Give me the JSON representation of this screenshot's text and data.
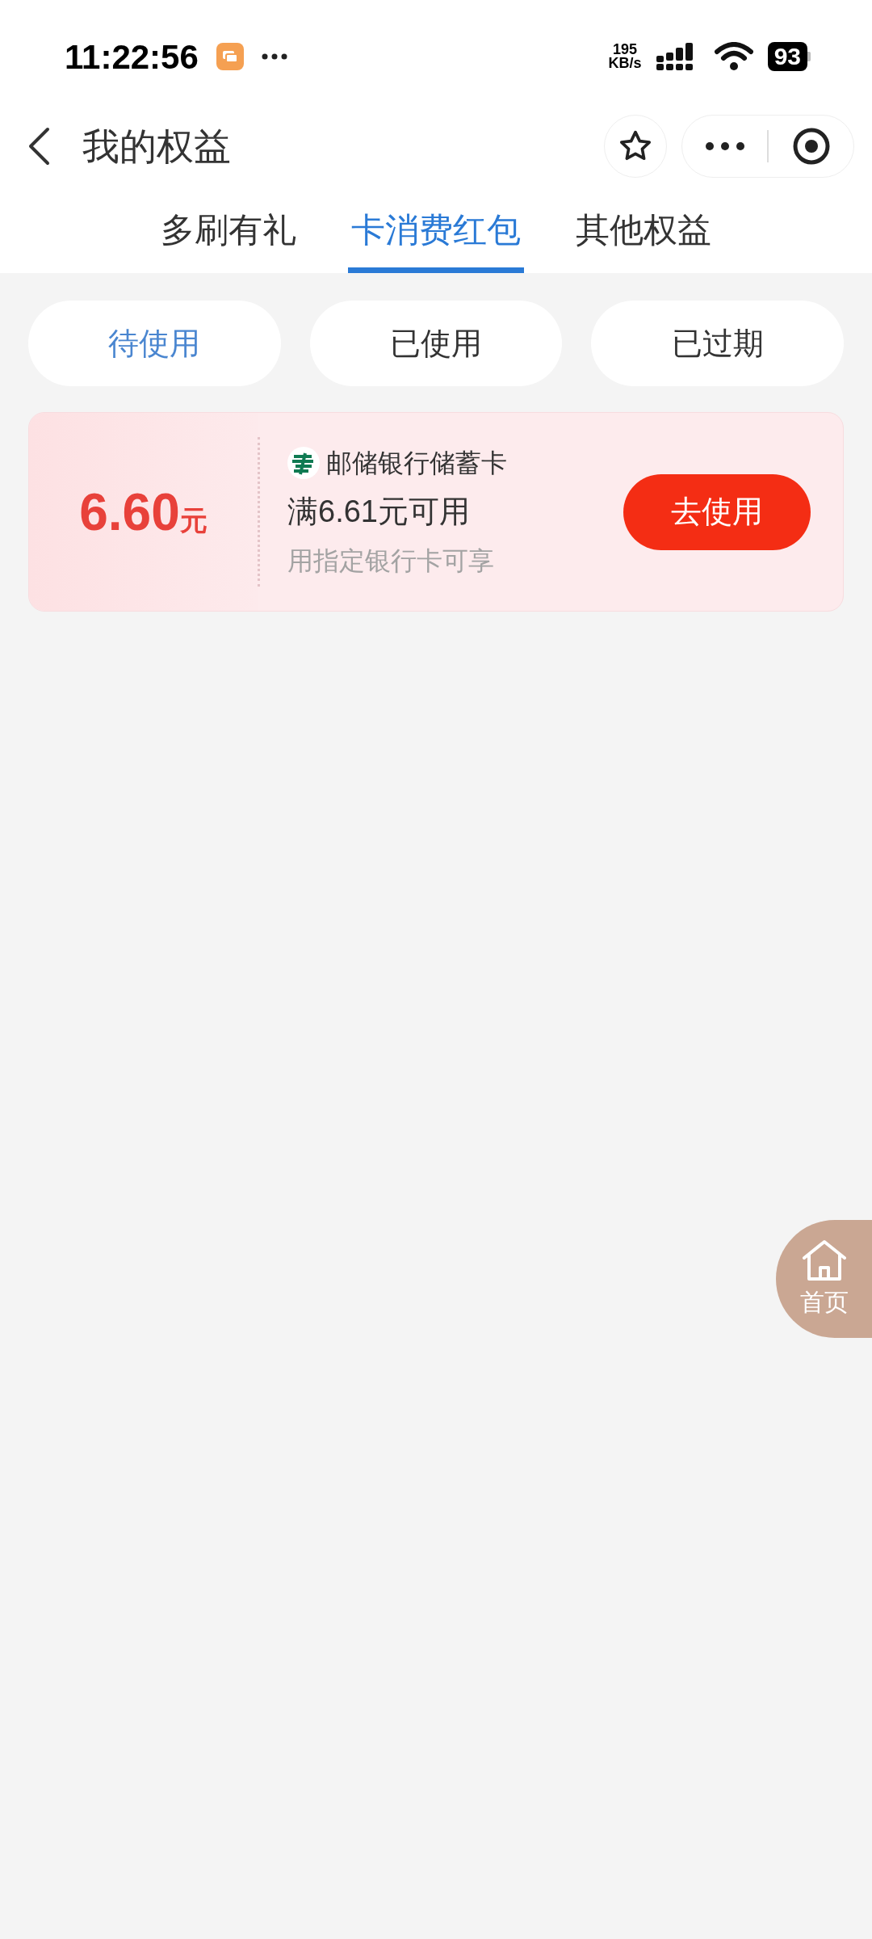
{
  "status_bar": {
    "time": "11:22:56",
    "network_speed": [
      "195",
      "KB/s"
    ],
    "battery": "93"
  },
  "header": {
    "title": "我的权益"
  },
  "tabs": [
    {
      "label": "多刷有礼",
      "selected": false
    },
    {
      "label": "卡消费红包",
      "selected": true
    },
    {
      "label": "其他权益",
      "selected": false
    }
  ],
  "filters": [
    {
      "label": "待使用",
      "selected": true
    },
    {
      "label": "已使用",
      "selected": false
    },
    {
      "label": "已过期",
      "selected": false
    }
  ],
  "coupons": [
    {
      "amount": "6.60",
      "unit": "元",
      "bank": "邮储银行储蓄卡",
      "condition": "满6.61元可用",
      "note": "用指定银行卡可享",
      "action": "去使用"
    }
  ],
  "home_button": {
    "label": "首页"
  }
}
